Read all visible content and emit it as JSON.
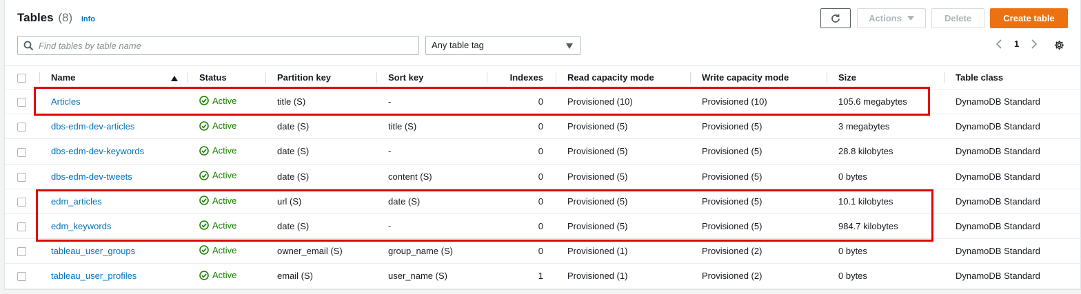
{
  "header": {
    "title": "Tables",
    "count": "(8)",
    "info": "Info"
  },
  "toolbar": {
    "refresh_icon": "refresh-icon",
    "actions_label": "Actions",
    "delete_label": "Delete",
    "create_label": "Create table",
    "accent_color": "#ec7211"
  },
  "filters": {
    "search_placeholder": "Find tables by table name",
    "tag_select": "Any table tag"
  },
  "pagination": {
    "prev": "<",
    "page": "1",
    "next": ">"
  },
  "table": {
    "columns": [
      "Name",
      "Status",
      "Partition key",
      "Sort key",
      "Indexes",
      "Read capacity mode",
      "Write capacity mode",
      "Size",
      "Table class"
    ],
    "sorted_by": "Name",
    "rows": [
      {
        "name": "Articles",
        "status": "Active",
        "partition": "title (S)",
        "sort": "-",
        "indexes": "0",
        "read": "Provisioned (10)",
        "write": "Provisioned (10)",
        "size": "105.6 megabytes",
        "class": "DynamoDB Standard"
      },
      {
        "name": "dbs-edm-dev-articles",
        "status": "Active",
        "partition": "date (S)",
        "sort": "title (S)",
        "indexes": "0",
        "read": "Provisioned (5)",
        "write": "Provisioned (5)",
        "size": "3 megabytes",
        "class": "DynamoDB Standard"
      },
      {
        "name": "dbs-edm-dev-keywords",
        "status": "Active",
        "partition": "date (S)",
        "sort": "-",
        "indexes": "0",
        "read": "Provisioned (5)",
        "write": "Provisioned (5)",
        "size": "28.8 kilobytes",
        "class": "DynamoDB Standard"
      },
      {
        "name": "dbs-edm-dev-tweets",
        "status": "Active",
        "partition": "date (S)",
        "sort": "content (S)",
        "indexes": "0",
        "read": "Provisioned (5)",
        "write": "Provisioned (5)",
        "size": "0 bytes",
        "class": "DynamoDB Standard"
      },
      {
        "name": "edm_articles",
        "status": "Active",
        "partition": "url (S)",
        "sort": "date (S)",
        "indexes": "0",
        "read": "Provisioned (5)",
        "write": "Provisioned (5)",
        "size": "10.1 kilobytes",
        "class": "DynamoDB Standard"
      },
      {
        "name": "edm_keywords",
        "status": "Active",
        "partition": "date (S)",
        "sort": "-",
        "indexes": "0",
        "read": "Provisioned (5)",
        "write": "Provisioned (5)",
        "size": "984.7 kilobytes",
        "class": "DynamoDB Standard"
      },
      {
        "name": "tableau_user_groups",
        "status": "Active",
        "partition": "owner_email (S)",
        "sort": "group_name (S)",
        "indexes": "0",
        "read": "Provisioned (1)",
        "write": "Provisioned (2)",
        "size": "0 bytes",
        "class": "DynamoDB Standard"
      },
      {
        "name": "tableau_user_profiles",
        "status": "Active",
        "partition": "email (S)",
        "sort": "user_name (S)",
        "indexes": "1",
        "read": "Provisioned (1)",
        "write": "Provisioned (2)",
        "size": "0 bytes",
        "class": "DynamoDB Standard"
      }
    ]
  },
  "annotations": {
    "highlight_color": "#e30000",
    "highlighted_rows": [
      "Articles",
      "edm_articles",
      "edm_keywords"
    ]
  }
}
